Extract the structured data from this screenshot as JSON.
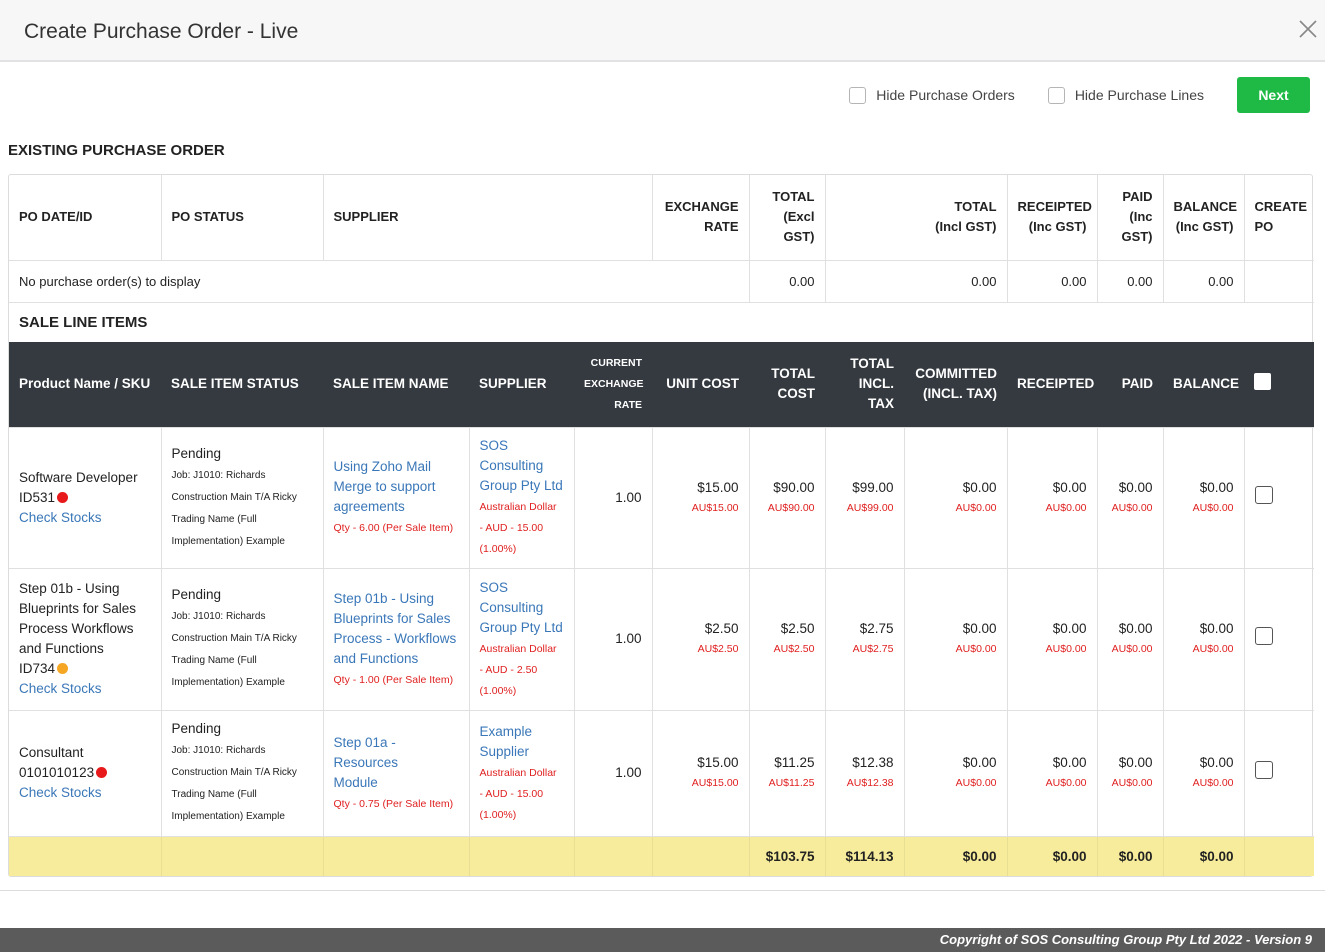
{
  "modal": {
    "title": "Create Purchase Order - Live"
  },
  "toolbar": {
    "hide_purchase_orders": "Hide Purchase Orders",
    "hide_purchase_lines": "Hide Purchase Lines",
    "next": "Next"
  },
  "existing_po": {
    "section_title": "EXISTING PURCHASE ORDER",
    "headers": {
      "date_id": "PO DATE/ID",
      "status": "PO STATUS",
      "supplier": "SUPPLIER",
      "exchange_rate_1": "EXCHANGE",
      "exchange_rate_2": "RATE",
      "total_excl_1": "TOTAL",
      "total_excl_2": "(Excl",
      "total_excl_3": "GST)",
      "total_incl_1": "TOTAL",
      "total_incl_2": "(Incl GST)",
      "receipted_1": "RECEIPTED",
      "receipted_2": "(Inc GST)",
      "paid_1": "PAID",
      "paid_2": "(Inc",
      "paid_3": "GST)",
      "balance_1": "BALANCE",
      "balance_2": "(Inc GST)",
      "create_po_1": "CREATE",
      "create_po_2": "PO"
    },
    "empty_message": "No purchase order(s) to display",
    "totals": {
      "excl": "0.00",
      "incl": "0.00",
      "receipted": "0.00",
      "paid": "0.00",
      "balance": "0.00"
    }
  },
  "sale_lines": {
    "section_title": "SALE LINE ITEMS",
    "headers": {
      "product": "Product Name / SKU",
      "status": "SALE ITEM STATUS",
      "name": "SALE ITEM NAME",
      "supplier": "SUPPLIER",
      "rate_1": "CURRENT",
      "rate_2": "EXCHANGE",
      "rate_3": "RATE",
      "unit_cost": "UNIT COST",
      "total_cost_1": "TOTAL",
      "total_cost_2": "COST",
      "total_incl_1": "TOTAL",
      "total_incl_2": "INCL.",
      "total_incl_3": "TAX",
      "committed_1": "COMMITTED",
      "committed_2": "(INCL. TAX)",
      "receipted": "RECEIPTED",
      "paid": "PAID",
      "balance": "BALANCE"
    },
    "items": [
      {
        "product_lines": [
          "Software Developer",
          "ID531"
        ],
        "dot_color": "#e8191b",
        "check_stocks": "Check Stocks",
        "status": "Pending",
        "job_lines": [
          "Job: J1010: Richards",
          "Construction Main T/A Ricky",
          "Trading Name (Full",
          "Implementation) Example"
        ],
        "name_lines": [
          "Using Zoho Mail",
          "Merge to support",
          "agreements"
        ],
        "qty": "Qty - 6.00 (Per Sale Item)",
        "supplier_lines": [
          "SOS",
          "Consulting",
          "Group Pty Ltd"
        ],
        "currency_lines": [
          "Australian Dollar",
          "- AUD - 15.00",
          "(1.00%)"
        ],
        "rate": "1.00",
        "unit_cost": "$15.00",
        "unit_cost_aud": "AU$15.00",
        "total_cost": "$90.00",
        "total_cost_aud": "AU$90.00",
        "total_incl": "$99.00",
        "total_incl_aud": "AU$99.00",
        "committed": "$0.00",
        "committed_aud": "AU$0.00",
        "receipted": "$0.00",
        "receipted_aud": "AU$0.00",
        "paid": "$0.00",
        "paid_aud": "AU$0.00",
        "balance": "$0.00",
        "balance_aud": "AU$0.00"
      },
      {
        "product_lines": [
          "Step 01b - Using",
          "Blueprints for Sales",
          "Process Workflows",
          "and Functions",
          "ID734"
        ],
        "dot_color": "#f5a623",
        "check_stocks": "Check Stocks",
        "status": "Pending",
        "job_lines": [
          "Job: J1010: Richards",
          "Construction Main T/A Ricky",
          "Trading Name (Full",
          "Implementation) Example"
        ],
        "name_lines": [
          "Step 01b - Using",
          "Blueprints for Sales",
          "Process - Workflows",
          "and Functions"
        ],
        "qty": "Qty - 1.00 (Per Sale Item)",
        "supplier_lines": [
          "SOS",
          "Consulting",
          "Group Pty Ltd"
        ],
        "currency_lines": [
          "Australian Dollar",
          "- AUD - 2.50",
          "(1.00%)"
        ],
        "rate": "1.00",
        "unit_cost": "$2.50",
        "unit_cost_aud": "AU$2.50",
        "total_cost": "$2.50",
        "total_cost_aud": "AU$2.50",
        "total_incl": "$2.75",
        "total_incl_aud": "AU$2.75",
        "committed": "$0.00",
        "committed_aud": "AU$0.00",
        "receipted": "$0.00",
        "receipted_aud": "AU$0.00",
        "paid": "$0.00",
        "paid_aud": "AU$0.00",
        "balance": "$0.00",
        "balance_aud": "AU$0.00"
      },
      {
        "product_lines": [
          "Consultant",
          "0101010123"
        ],
        "dot_color": "#e8191b",
        "check_stocks": "Check Stocks",
        "status": "Pending",
        "job_lines": [
          "Job: J1010: Richards",
          "Construction Main T/A Ricky",
          "Trading Name (Full",
          "Implementation) Example"
        ],
        "name_lines": [
          "Step 01a - Resources",
          "Module"
        ],
        "qty": "Qty - 0.75 (Per Sale Item)",
        "supplier_lines": [
          "Example",
          "Supplier"
        ],
        "currency_lines": [
          "Australian Dollar",
          "- AUD - 15.00",
          "(1.00%)"
        ],
        "rate": "1.00",
        "unit_cost": "$15.00",
        "unit_cost_aud": "AU$15.00",
        "total_cost": "$11.25",
        "total_cost_aud": "AU$11.25",
        "total_incl": "$12.38",
        "total_incl_aud": "AU$12.38",
        "committed": "$0.00",
        "committed_aud": "AU$0.00",
        "receipted": "$0.00",
        "receipted_aud": "AU$0.00",
        "paid": "$0.00",
        "paid_aud": "AU$0.00",
        "balance": "$0.00",
        "balance_aud": "AU$0.00"
      }
    ],
    "totals": {
      "total_cost": "$103.75",
      "total_incl": "$114.13",
      "committed": "$0.00",
      "receipted": "$0.00",
      "paid": "$0.00",
      "balance": "$0.00"
    }
  },
  "footer": {
    "copyright": "Copyright of SOS Consulting Group Pty Ltd 2022 - Version 9"
  },
  "icons": {
    "close": "close-icon"
  },
  "colors": {
    "accent_green": "#1fba45",
    "header_dark": "#343a40",
    "totals_yellow": "#f7ec9b",
    "link_blue": "#3a77b8",
    "alert_red": "#e02020"
  }
}
